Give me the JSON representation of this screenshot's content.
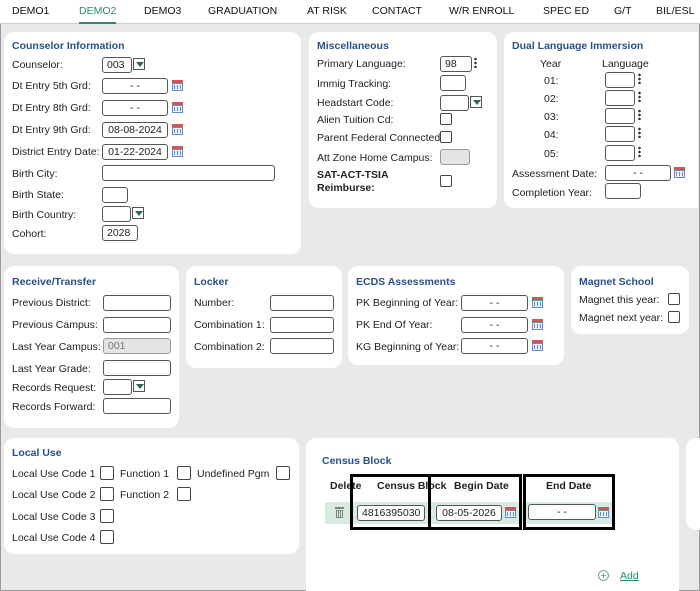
{
  "tabs": [
    {
      "label": "DEMO1"
    },
    {
      "label": "DEMO2"
    },
    {
      "label": "DEMO3"
    },
    {
      "label": "GRADUATION"
    },
    {
      "label": "AT RISK"
    },
    {
      "label": "CONTACT"
    },
    {
      "label": "W/R ENROLL"
    },
    {
      "label": "SPEC ED"
    },
    {
      "label": "G/T"
    },
    {
      "label": "BIL/ESL"
    }
  ],
  "active_tab": "DEMO2",
  "counselor": {
    "title": "Counselor Information",
    "counselor_label": "Counselor:",
    "counselor_value": "003",
    "dt5_label": "Dt Entry 5th Grd:",
    "dt5_value": "  -  -",
    "dt8_label": "Dt Entry 8th Grd:",
    "dt8_value": "  -  -",
    "dt9_label": "Dt Entry 9th Grd:",
    "dt9_value": "08-08-2024",
    "district_label": "District Entry Date:",
    "district_value": "01-22-2024",
    "city_label": "Birth City:",
    "city_value": "",
    "state_label": "Birth State:",
    "state_value": "",
    "country_label": "Birth Country:",
    "country_value": "",
    "cohort_label": "Cohort:",
    "cohort_value": "2028"
  },
  "misc": {
    "title": "Miscellaneous",
    "language_label": "Primary Language:",
    "language_value": "98",
    "immig_label": "Immig Tracking:",
    "headstart_label": "Headstart Code:",
    "alien_label": "Alien Tuition Cd:",
    "parent_label": "Parent Federal Connected:",
    "attzone_label": "Att Zone Home Campus:",
    "sat_label_1": "SAT-ACT-TSIA",
    "sat_label_2": "Reimburse:"
  },
  "dli": {
    "title": "Dual Language Immersion",
    "year_header": "Year",
    "language_header": "Language",
    "rows": [
      "01:",
      "02:",
      "03:",
      "04:",
      "05:"
    ],
    "assessment_label": "Assessment Date:",
    "assessment_value": "  -  -",
    "completion_label": "Completion Year:"
  },
  "receive": {
    "title": "Receive/Transfer",
    "prev_district_label": "Previous District:",
    "prev_campus_label": "Previous Campus:",
    "last_campus_label": "Last Year Campus:",
    "last_campus_value": "001",
    "last_grade_label": "Last Year Grade:",
    "records_request_label": "Records Request:",
    "records_forward_label": "Records Forward:"
  },
  "locker": {
    "title": "Locker",
    "number_label": "Number:",
    "combo1_label": "Combination 1:",
    "combo2_label": "Combination 2:"
  },
  "ecds": {
    "title": "ECDS Assessments",
    "pk_begin_label": "PK Beginning of Year:",
    "pk_begin_value": "  -  -",
    "pk_end_label": "PK End Of Year:",
    "pk_end_value": "  -  -",
    "kg_begin_label": "KG Beginning of Year:",
    "kg_begin_value": "  -  -"
  },
  "magnet": {
    "title": "Magnet School",
    "this_year_label": "Magnet this year:",
    "next_year_label": "Magnet next year:"
  },
  "local": {
    "title": "Local Use",
    "code1_label": "Local Use Code 1",
    "code2_label": "Local Use Code 2",
    "code3_label": "Local Use Code 3",
    "code4_label": "Local Use Code 4",
    "function1_label": "Function 1",
    "function2_label": "Function 2",
    "undefined_label": "Undefined Pgm"
  },
  "census": {
    "title": "Census Block",
    "col_delete": "Delete",
    "col_block": "Census Block",
    "col_begin": "Begin Date",
    "col_end": "End Date",
    "block_value": "4816395030",
    "begin_value": "08-05-2026",
    "end_value": "  -  -",
    "add_label": "Add"
  },
  "colors": {
    "accent": "#2c8a6a",
    "title": "#2a4f8a",
    "row_highlight": "#d7ebe0"
  }
}
